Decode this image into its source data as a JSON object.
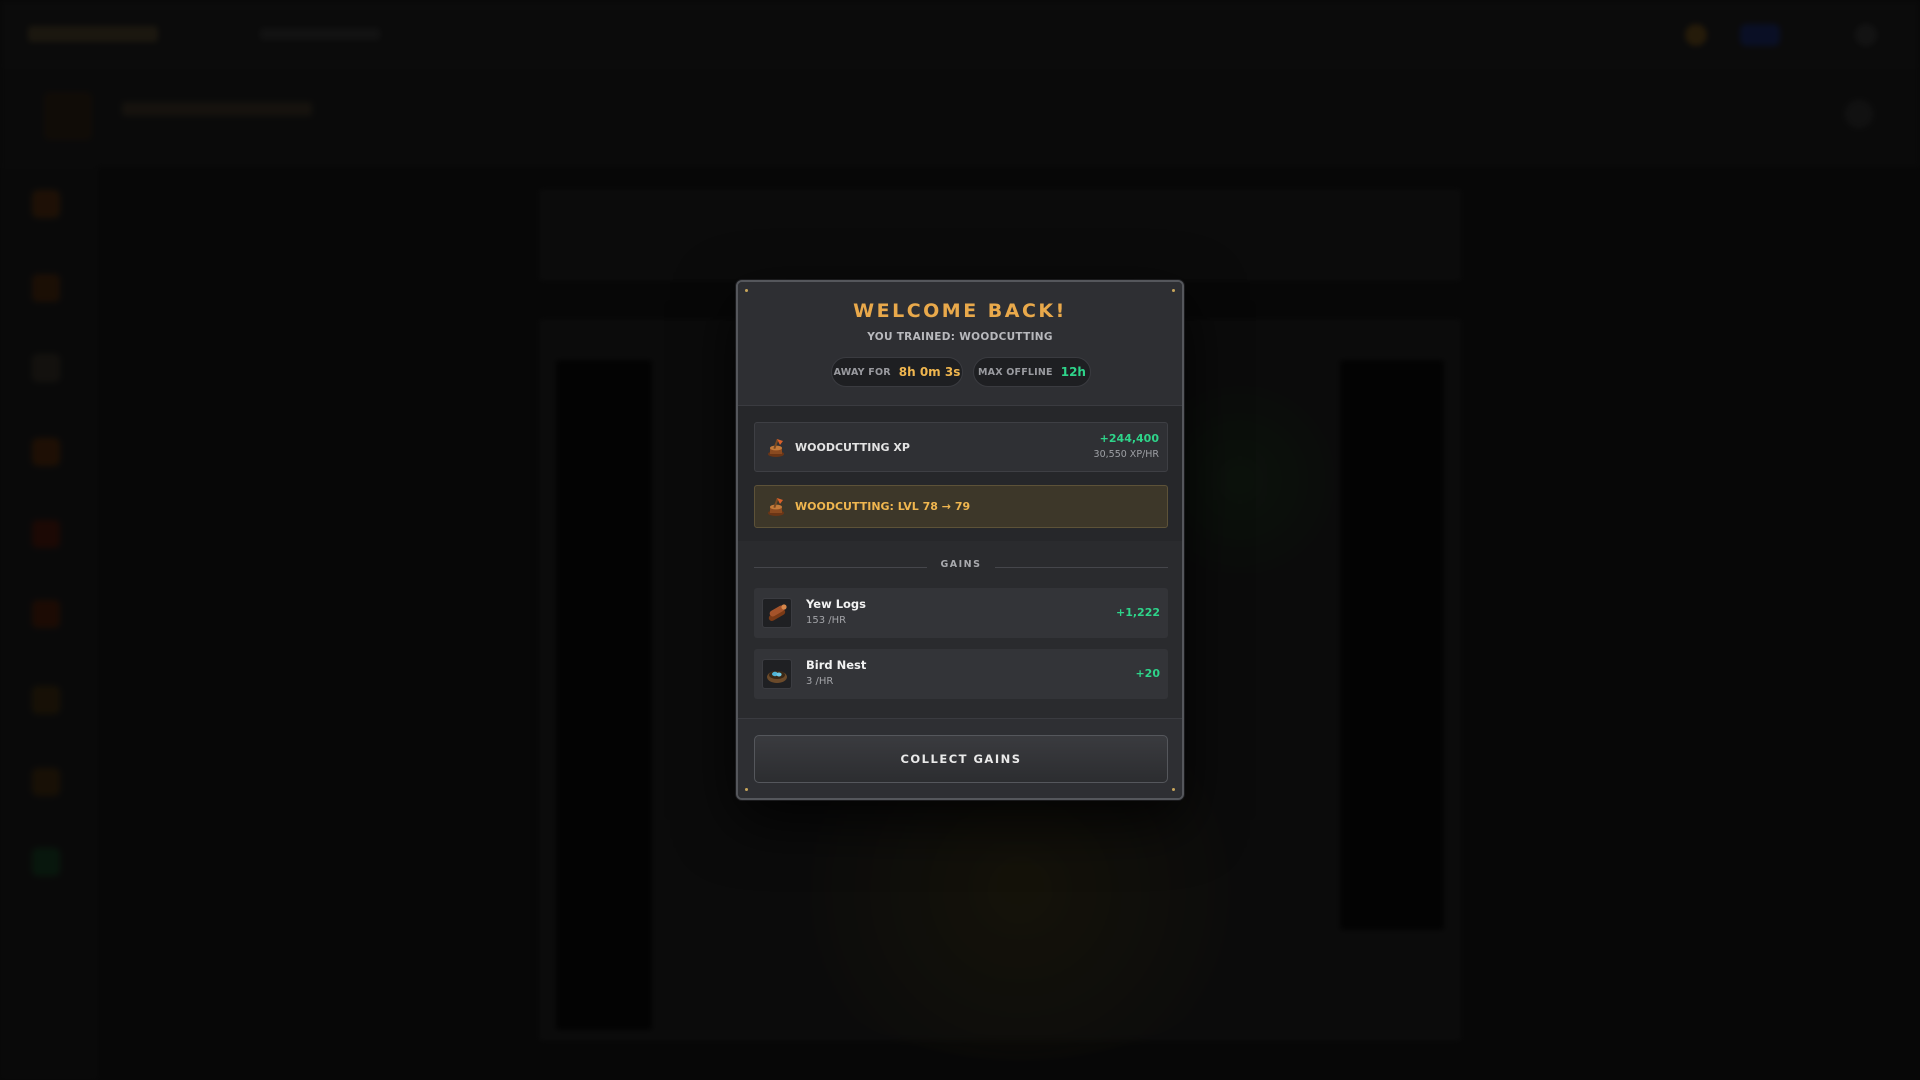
{
  "modal": {
    "title": "WELCOME BACK!",
    "subtitle": "YOU TRAINED: WOODCUTTING",
    "away": {
      "label": "AWAY FOR",
      "value": "8h 0m 3s"
    },
    "max_offline": {
      "label": "MAX OFFLINE",
      "value": "12h"
    },
    "xp_row": {
      "icon": "woodcutting-axe-icon",
      "label": "WOODCUTTING XP",
      "gain": "+244,400",
      "rate": "30,550 XP/HR"
    },
    "level_row": {
      "icon": "woodcutting-axe-icon",
      "label": "WOODCUTTING: LVL 78 → 79"
    },
    "gains_title": "GAINS",
    "gains": [
      {
        "icon": "yew-logs-icon",
        "name": "Yew Logs",
        "rate": "153 /HR",
        "amount": "+1,222"
      },
      {
        "icon": "bird-nest-icon",
        "name": "Bird Nest",
        "rate": "3 /HR",
        "amount": "+20"
      }
    ],
    "collect_label": "COLLECT GAINS"
  },
  "colors": {
    "title_orange": "#e9a94b",
    "gain_green": "#2ed48a",
    "level_highlight": "#3d3729",
    "modal_bg": "#2b2c2f"
  }
}
